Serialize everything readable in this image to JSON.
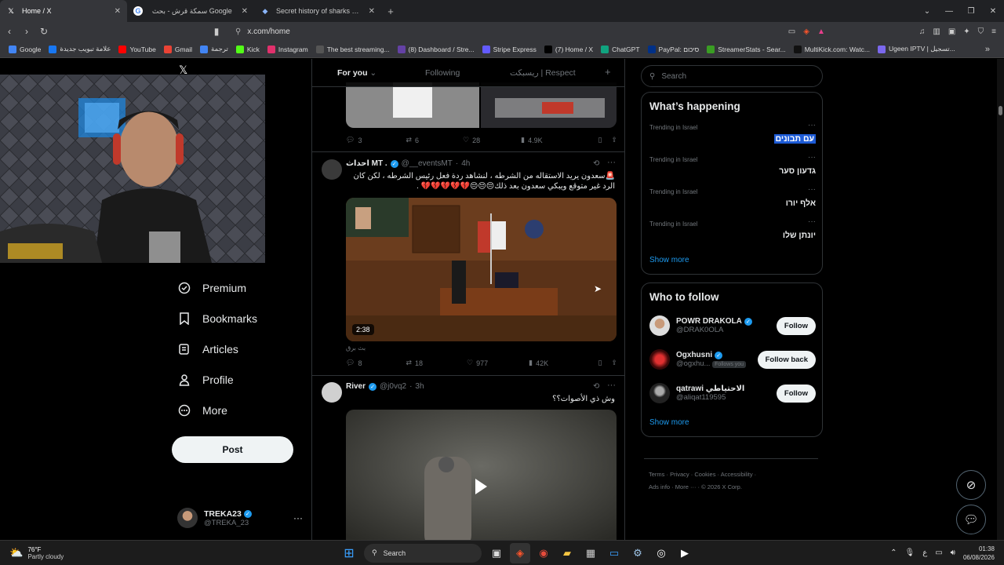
{
  "browser": {
    "tabs": [
      {
        "title": "Home / X",
        "icon": "x-logo",
        "active": true
      },
      {
        "title": "سمكة قرش - بحث Google",
        "icon": "google-icon",
        "active": false
      },
      {
        "title": "Secret history of sharks – News",
        "icon": "news-icon",
        "active": false
      }
    ],
    "url": "x.com/home",
    "bookmarks": [
      {
        "label": "Google",
        "color": "#4285f4"
      },
      {
        "label": "علامة تبويب جديدة",
        "color": "#1877f2"
      },
      {
        "label": "YouTube",
        "color": "#ff0000"
      },
      {
        "label": "Gmail",
        "color": "#ea4335"
      },
      {
        "label": "ترجمة",
        "color": "#4285f4"
      },
      {
        "label": "Kick",
        "color": "#53fc18"
      },
      {
        "label": "Instagram",
        "color": "#e1306c"
      },
      {
        "label": "The best streaming...",
        "color": "#555555"
      },
      {
        "label": "(8) Dashboard / Stre...",
        "color": "#6441a5"
      },
      {
        "label": "Stripe Express",
        "color": "#635bff"
      },
      {
        "label": "(7) Home / X",
        "color": "#000000"
      },
      {
        "label": "ChatGPT",
        "color": "#10a37f"
      },
      {
        "label": "PayPal: סיכום",
        "color": "#003087"
      },
      {
        "label": "StreamerStats - Sear...",
        "color": "#3a9d23"
      },
      {
        "label": "MultiKick.com: Watc...",
        "color": "#111111"
      },
      {
        "label": "Ugeen IPTV | تسجيل...",
        "color": "#7b68ee"
      }
    ]
  },
  "nav": {
    "items": [
      {
        "label": "Premium",
        "icon": "premium-icon"
      },
      {
        "label": "Bookmarks",
        "icon": "bookmark-icon"
      },
      {
        "label": "Articles",
        "icon": "articles-icon"
      },
      {
        "label": "Profile",
        "icon": "profile-icon"
      },
      {
        "label": "More",
        "icon": "more-icon"
      }
    ],
    "post_label": "Post",
    "account": {
      "name": "TREKA23",
      "handle": "@TREKA_23"
    }
  },
  "feed": {
    "tabs": [
      "For you",
      "Following",
      "ريسبكت | Respect"
    ],
    "top_actions": {
      "replies": "3",
      "reposts": "6",
      "likes": "28",
      "views": "4.9K"
    },
    "tweets": [
      {
        "name": "احداث MT .",
        "handle": "@__eventsMT",
        "time": "4h",
        "text": "🚨سعدون يريد الاستقاله من الشرطه ، لنشاهد ردة فعل رئيس الشرطه ، لكن كان الرد غير متوقع ويبكي سعدون بعد ذلك😔😔😔💔💔💔💔💔 .",
        "video_time": "2:38",
        "caption": "بث برق",
        "replies": "8",
        "reposts": "18",
        "likes": "977",
        "views": "42K"
      },
      {
        "name": "River",
        "handle": "@j0vq2",
        "time": "3h",
        "text": "وش ذي الأصوات؟؟"
      }
    ]
  },
  "sidebar": {
    "search_placeholder": "Search",
    "happening_title": "What’s happening",
    "trends": [
      {
        "location": "Trending in Israel",
        "name": "עם תבונים"
      },
      {
        "location": "Trending in Israel",
        "name": "גדעון סער"
      },
      {
        "location": "Trending in Israel",
        "name": "אלף יורו"
      },
      {
        "location": "Trending in Israel",
        "name": "יונתן שלו"
      }
    ],
    "show_more": "Show more",
    "follow_title": "Who to follow",
    "follow": [
      {
        "name": "POWR DRAKOLA",
        "handle": "@DRAK0OLA",
        "button": "Follow",
        "follows_you": ""
      },
      {
        "name": "Ogxhusni",
        "handle": "@ogxhu...",
        "button": "Follow back",
        "follows_you": "Follows you"
      },
      {
        "name": "qatrawi الاحتياطي",
        "handle": "@aliqat119595",
        "button": "Follow",
        "follows_you": ""
      }
    ],
    "footer_links": [
      "Terms",
      "Privacy",
      "Cookies",
      "Accessibility",
      "Ads info",
      "More",
      "© 2026 X Corp."
    ]
  },
  "taskbar": {
    "weather_temp": "76°F",
    "weather_desc": "Partly cloudy",
    "search": "Search",
    "time": "01:38",
    "date": "06/08/2026",
    "lang": "ع"
  }
}
